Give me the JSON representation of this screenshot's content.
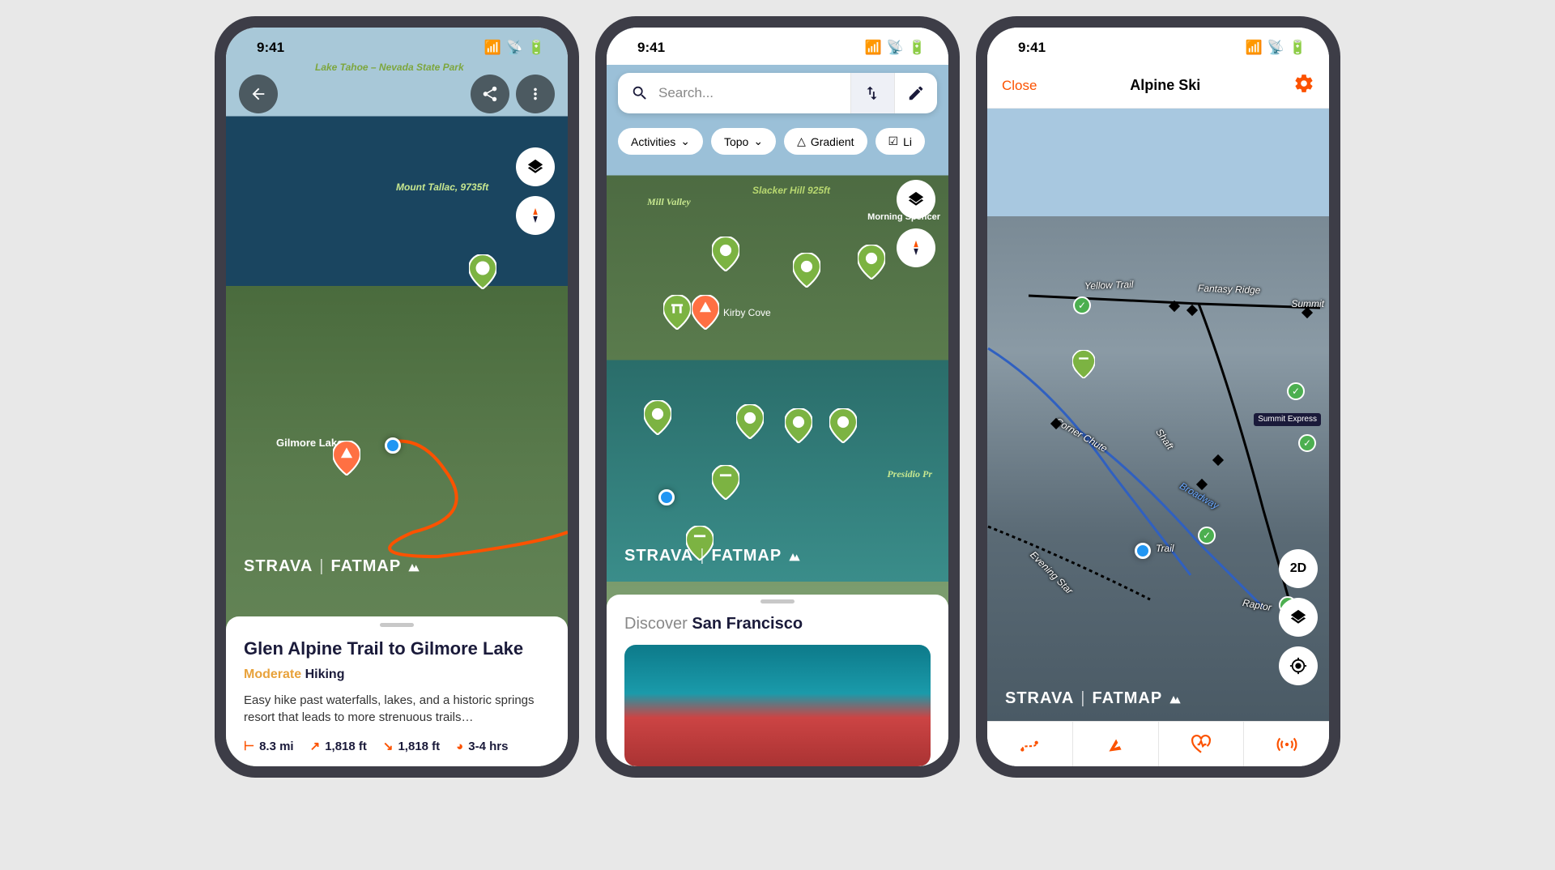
{
  "status": {
    "time": "9:41"
  },
  "brand": {
    "strava": "STRAVA",
    "fatmap": "FATMAP"
  },
  "colors": {
    "accent": "#fc5200",
    "difficulty": "#e8a23b"
  },
  "phone1": {
    "map_labels": {
      "park": "Lake Tahoe –\nNevada State\nPark",
      "mount": "Mount Tallac,\n9735ft",
      "gilmore": "Gilmore Lake"
    },
    "card": {
      "title": "Glen Alpine Trail to Gilmore Lake",
      "difficulty": "Moderate",
      "type": "Hiking",
      "desc": "Easy hike past waterfalls, lakes, and a historic springs resort that leads to more strenuous trails…",
      "distance": "8.3 mi",
      "ascent": "1,818 ft",
      "descent": "1,818 ft",
      "duration": "3-4 hrs"
    }
  },
  "phone2": {
    "search": {
      "placeholder": "Search..."
    },
    "filters": [
      "Activities",
      "Topo",
      "Gradient",
      "Li"
    ],
    "map_labels": {
      "mill": "Mill Valley",
      "slacker": "Slacker Hill\n925ft",
      "kirby": "Kirby Cove",
      "presidio": "Presidio Pr",
      "morning": "Morning\nSpencer"
    },
    "discover": {
      "prefix": "Discover",
      "place": "San Francisco"
    }
  },
  "phone3": {
    "nav": {
      "close": "Close",
      "title": "Alpine Ski"
    },
    "ski_labels": {
      "yellow": "Yellow Trail",
      "fantasy": "Fantasy Ridge",
      "summit_trail": "Summit",
      "corner": "Corner Chute",
      "shaft": "Shaft",
      "broadway": "Broadway",
      "evening": "Evening Star",
      "raptor": "Raptor",
      "trail": "Trail"
    },
    "lift": {
      "summit": "Summit\nExpress"
    },
    "btn_2d": "2D"
  }
}
